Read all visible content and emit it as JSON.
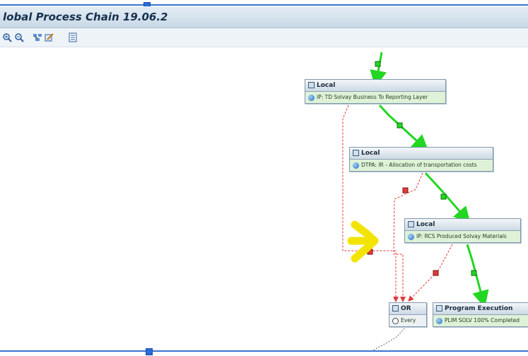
{
  "window": {
    "title": "lobal Process Chain 19.06.2"
  },
  "toolbar": {
    "icons": [
      "zoom-in-icon",
      "zoom-out-icon",
      "layout-icon",
      "edit-icon",
      "list-icon"
    ]
  },
  "nodes": {
    "local1": {
      "header": "Local",
      "body": "IP: TD Solvay Business To Reporting Layer"
    },
    "local2": {
      "header": "Local",
      "body": "DTPA: IR - Allocation of transportation costs"
    },
    "local3": {
      "header": "Local",
      "body": "IP: RCS Produced Solvay Materials"
    },
    "or": {
      "header": "OR",
      "body": "Every"
    },
    "program": {
      "header": "Program Execution",
      "body": "PLIM SOLV 100% Completed"
    }
  },
  "colors": {
    "success": "#22d622",
    "failure": "#e23a3a",
    "annotation": "#f2e400",
    "frame": "#3b73d1"
  }
}
